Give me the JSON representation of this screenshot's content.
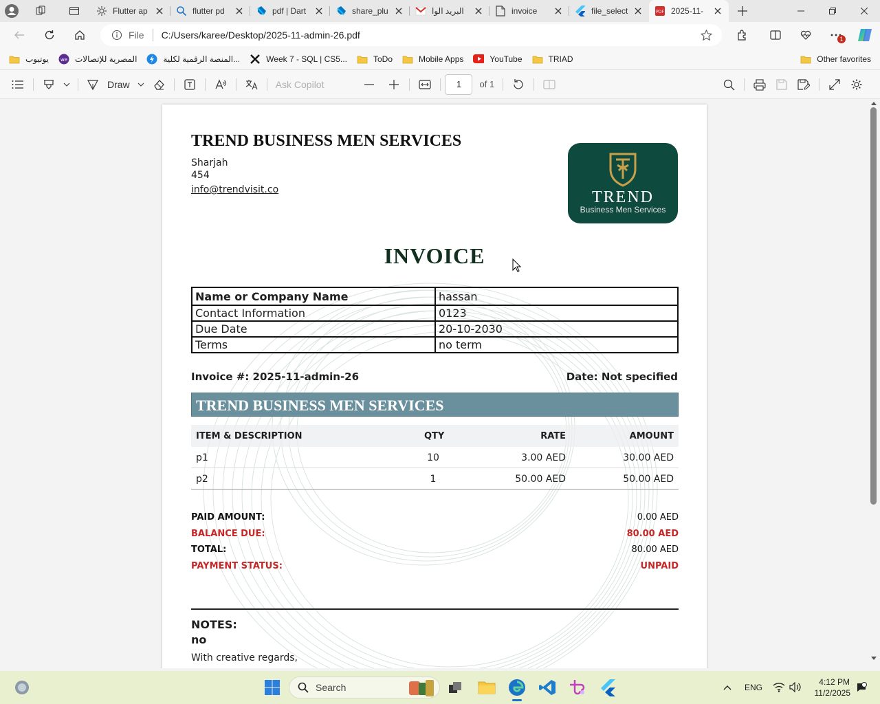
{
  "browser": {
    "tabs": [
      {
        "title": "Flutter ap",
        "icon": "gear-icon"
      },
      {
        "title": "flutter pd",
        "icon": "search-icon"
      },
      {
        "title": "pdf | Dart",
        "icon": "dart-icon"
      },
      {
        "title": "share_plu",
        "icon": "dart-icon"
      },
      {
        "title": "البريد الوا",
        "icon": "gmail-icon"
      },
      {
        "title": "invoice",
        "icon": "document-icon"
      },
      {
        "title": "file_select",
        "icon": "flutter-icon"
      },
      {
        "title": "2025-11-",
        "icon": "pdf-icon",
        "active": true
      }
    ],
    "address": {
      "scheme_label": "File",
      "url": "C:/Users/karee/Desktop/2025-11-admin-26.pdf"
    },
    "notification_badge": "1",
    "favorites": [
      {
        "label": "يوتيوب",
        "icon": "folder-icon"
      },
      {
        "label": "المصرية للإتصالات",
        "icon": "we-icon"
      },
      {
        "label": "المنصة الرقمية لكلية...",
        "icon": "platform-icon"
      },
      {
        "label": "Week 7 - SQL | CS5...",
        "icon": "x-logo-icon"
      },
      {
        "label": "ToDo",
        "icon": "folder-icon"
      },
      {
        "label": "Mobile Apps",
        "icon": "folder-icon"
      },
      {
        "label": "YouTube",
        "icon": "youtube-icon"
      },
      {
        "label": "TRIAD",
        "icon": "folder-icon"
      }
    ],
    "other_favorites": "Other favorites"
  },
  "pdf_toolbar": {
    "draw_label": "Draw",
    "ask_copilot": "Ask Copilot",
    "page_number": "1",
    "page_total": "of 1"
  },
  "invoice": {
    "company_name": "TREND BUSINESS MEN SERVICES",
    "city": "Sharjah",
    "address_number": "454",
    "email": "info@trendvisit.co",
    "logo": {
      "word": "TREND",
      "sub": "Business Men Services"
    },
    "title": "INVOICE",
    "info_rows": [
      {
        "label": "Name or Company Name",
        "value": "hassan"
      },
      {
        "label": "Contact Information",
        "value": "0123"
      },
      {
        "label": "Due Date",
        "value": "20-10-2030"
      },
      {
        "label": "Terms",
        "value": "no term"
      }
    ],
    "invoice_number": "Invoice #: 2025-11-admin-26",
    "date": "Date: Not specified",
    "banner": "TREND BUSINESS MEN SERVICES",
    "columns": [
      "ITEM & DESCRIPTION",
      "QTY",
      "RATE",
      "AMOUNT"
    ],
    "items": [
      {
        "desc": "p1",
        "qty": "10",
        "rate": "3.00 AED",
        "amount": "30.00 AED"
      },
      {
        "desc": "p2",
        "qty": "1",
        "rate": "50.00 AED",
        "amount": "50.00 AED"
      }
    ],
    "totals": [
      {
        "label": "PAID AMOUNT:",
        "value": "0.00 AED",
        "highlight": false
      },
      {
        "label": "BALANCE DUE:",
        "value": "80.00 AED",
        "highlight": true
      },
      {
        "label": "TOTAL:",
        "value": "80.00 AED",
        "highlight": false
      },
      {
        "label": "PAYMENT STATUS:",
        "value": "UNPAID",
        "highlight": true
      }
    ],
    "notes_label": "NOTES:",
    "notes_value": "no",
    "closing": "With creative regards,"
  },
  "taskbar": {
    "search_placeholder": "Search",
    "language": "ENG",
    "time": "4:12 PM",
    "date": "11/2/2025"
  },
  "colors": {
    "logo_green": "#0e4a3e",
    "logo_gold": "#c9a04a",
    "banner": "#6a8f9d",
    "alert_red": "#c62828",
    "invoice_title": "#12301f",
    "edge_blue": "#1a73c8"
  }
}
